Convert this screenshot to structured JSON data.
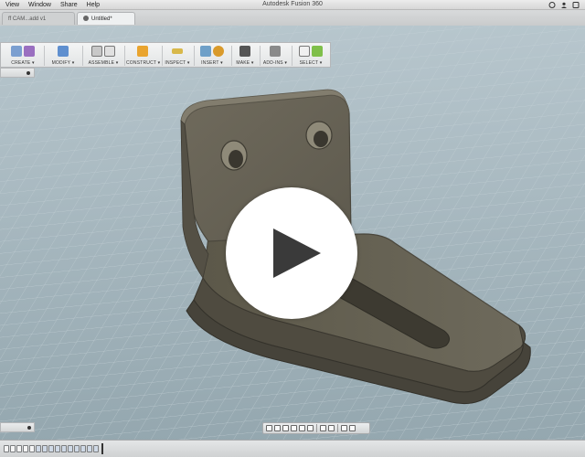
{
  "menubar": {
    "items": [
      "View",
      "Window",
      "Share",
      "Help"
    ],
    "app_title": "Autodesk Fusion 360"
  },
  "tabs": [
    {
      "label": "ff CAM...add v1"
    },
    {
      "label": "Untitled*"
    }
  ],
  "toolbar": {
    "groups": [
      {
        "label": "CREATE ▾"
      },
      {
        "label": "MODIFY ▾"
      },
      {
        "label": "ASSEMBLE ▾"
      },
      {
        "label": "CONSTRUCT ▾"
      },
      {
        "label": "INSPECT ▾"
      },
      {
        "label": "INSERT ▾"
      },
      {
        "label": "MAKE ▾"
      },
      {
        "label": "ADD-INS ▾"
      },
      {
        "label": "SELECT ▾"
      }
    ]
  },
  "colors": {
    "grid_bg": "#a7b7bf",
    "part_face": "#6b6657",
    "part_edge": "#8a8576",
    "play_bg": "#ffffff",
    "play_icon": "#3a3a3a"
  },
  "icons": {
    "play": "play-icon",
    "apple": "apple-icon"
  }
}
